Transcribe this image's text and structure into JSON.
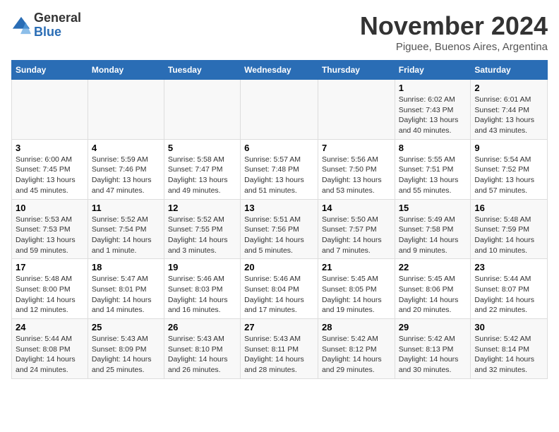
{
  "header": {
    "logo_general": "General",
    "logo_blue": "Blue",
    "month_title": "November 2024",
    "location": "Piguee, Buenos Aires, Argentina"
  },
  "columns": [
    "Sunday",
    "Monday",
    "Tuesday",
    "Wednesday",
    "Thursday",
    "Friday",
    "Saturday"
  ],
  "weeks": [
    {
      "days": [
        {
          "num": "",
          "info": ""
        },
        {
          "num": "",
          "info": ""
        },
        {
          "num": "",
          "info": ""
        },
        {
          "num": "",
          "info": ""
        },
        {
          "num": "",
          "info": ""
        },
        {
          "num": "1",
          "info": "Sunrise: 6:02 AM\nSunset: 7:43 PM\nDaylight: 13 hours\nand 40 minutes."
        },
        {
          "num": "2",
          "info": "Sunrise: 6:01 AM\nSunset: 7:44 PM\nDaylight: 13 hours\nand 43 minutes."
        }
      ]
    },
    {
      "days": [
        {
          "num": "3",
          "info": "Sunrise: 6:00 AM\nSunset: 7:45 PM\nDaylight: 13 hours\nand 45 minutes."
        },
        {
          "num": "4",
          "info": "Sunrise: 5:59 AM\nSunset: 7:46 PM\nDaylight: 13 hours\nand 47 minutes."
        },
        {
          "num": "5",
          "info": "Sunrise: 5:58 AM\nSunset: 7:47 PM\nDaylight: 13 hours\nand 49 minutes."
        },
        {
          "num": "6",
          "info": "Sunrise: 5:57 AM\nSunset: 7:48 PM\nDaylight: 13 hours\nand 51 minutes."
        },
        {
          "num": "7",
          "info": "Sunrise: 5:56 AM\nSunset: 7:50 PM\nDaylight: 13 hours\nand 53 minutes."
        },
        {
          "num": "8",
          "info": "Sunrise: 5:55 AM\nSunset: 7:51 PM\nDaylight: 13 hours\nand 55 minutes."
        },
        {
          "num": "9",
          "info": "Sunrise: 5:54 AM\nSunset: 7:52 PM\nDaylight: 13 hours\nand 57 minutes."
        }
      ]
    },
    {
      "days": [
        {
          "num": "10",
          "info": "Sunrise: 5:53 AM\nSunset: 7:53 PM\nDaylight: 13 hours\nand 59 minutes."
        },
        {
          "num": "11",
          "info": "Sunrise: 5:52 AM\nSunset: 7:54 PM\nDaylight: 14 hours\nand 1 minute."
        },
        {
          "num": "12",
          "info": "Sunrise: 5:52 AM\nSunset: 7:55 PM\nDaylight: 14 hours\nand 3 minutes."
        },
        {
          "num": "13",
          "info": "Sunrise: 5:51 AM\nSunset: 7:56 PM\nDaylight: 14 hours\nand 5 minutes."
        },
        {
          "num": "14",
          "info": "Sunrise: 5:50 AM\nSunset: 7:57 PM\nDaylight: 14 hours\nand 7 minutes."
        },
        {
          "num": "15",
          "info": "Sunrise: 5:49 AM\nSunset: 7:58 PM\nDaylight: 14 hours\nand 9 minutes."
        },
        {
          "num": "16",
          "info": "Sunrise: 5:48 AM\nSunset: 7:59 PM\nDaylight: 14 hours\nand 10 minutes."
        }
      ]
    },
    {
      "days": [
        {
          "num": "17",
          "info": "Sunrise: 5:48 AM\nSunset: 8:00 PM\nDaylight: 14 hours\nand 12 minutes."
        },
        {
          "num": "18",
          "info": "Sunrise: 5:47 AM\nSunset: 8:01 PM\nDaylight: 14 hours\nand 14 minutes."
        },
        {
          "num": "19",
          "info": "Sunrise: 5:46 AM\nSunset: 8:03 PM\nDaylight: 14 hours\nand 16 minutes."
        },
        {
          "num": "20",
          "info": "Sunrise: 5:46 AM\nSunset: 8:04 PM\nDaylight: 14 hours\nand 17 minutes."
        },
        {
          "num": "21",
          "info": "Sunrise: 5:45 AM\nSunset: 8:05 PM\nDaylight: 14 hours\nand 19 minutes."
        },
        {
          "num": "22",
          "info": "Sunrise: 5:45 AM\nSunset: 8:06 PM\nDaylight: 14 hours\nand 20 minutes."
        },
        {
          "num": "23",
          "info": "Sunrise: 5:44 AM\nSunset: 8:07 PM\nDaylight: 14 hours\nand 22 minutes."
        }
      ]
    },
    {
      "days": [
        {
          "num": "24",
          "info": "Sunrise: 5:44 AM\nSunset: 8:08 PM\nDaylight: 14 hours\nand 24 minutes."
        },
        {
          "num": "25",
          "info": "Sunrise: 5:43 AM\nSunset: 8:09 PM\nDaylight: 14 hours\nand 25 minutes."
        },
        {
          "num": "26",
          "info": "Sunrise: 5:43 AM\nSunset: 8:10 PM\nDaylight: 14 hours\nand 26 minutes."
        },
        {
          "num": "27",
          "info": "Sunrise: 5:43 AM\nSunset: 8:11 PM\nDaylight: 14 hours\nand 28 minutes."
        },
        {
          "num": "28",
          "info": "Sunrise: 5:42 AM\nSunset: 8:12 PM\nDaylight: 14 hours\nand 29 minutes."
        },
        {
          "num": "29",
          "info": "Sunrise: 5:42 AM\nSunset: 8:13 PM\nDaylight: 14 hours\nand 30 minutes."
        },
        {
          "num": "30",
          "info": "Sunrise: 5:42 AM\nSunset: 8:14 PM\nDaylight: 14 hours\nand 32 minutes."
        }
      ]
    }
  ]
}
